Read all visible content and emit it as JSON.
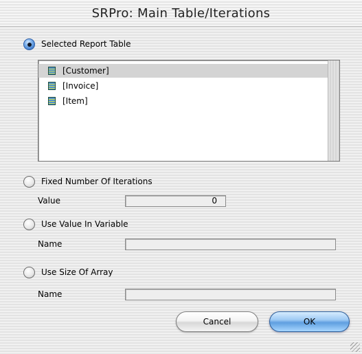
{
  "window": {
    "title": "SRPro: Main Table/Iterations"
  },
  "options": {
    "selected_report_table": "Selected Report Table",
    "fixed_iterations": "Fixed Number Of Iterations",
    "value_in_variable": "Use Value In Variable",
    "size_of_array": "Use Size Of Array"
  },
  "table_list": {
    "items": [
      "[Customer]",
      "[Invoice]",
      "[Item]"
    ],
    "selected": "[Customer]"
  },
  "fields": {
    "value_label": "Value",
    "value": "0",
    "variable_name_label": "Name",
    "variable_name": "",
    "array_name_label": "Name",
    "array_name": ""
  },
  "buttons": {
    "cancel": "Cancel",
    "ok": "OK"
  },
  "colors": {
    "accent": "#2a64b8",
    "selection": "#d4d4d4",
    "default_button": "#6fa6e6"
  }
}
